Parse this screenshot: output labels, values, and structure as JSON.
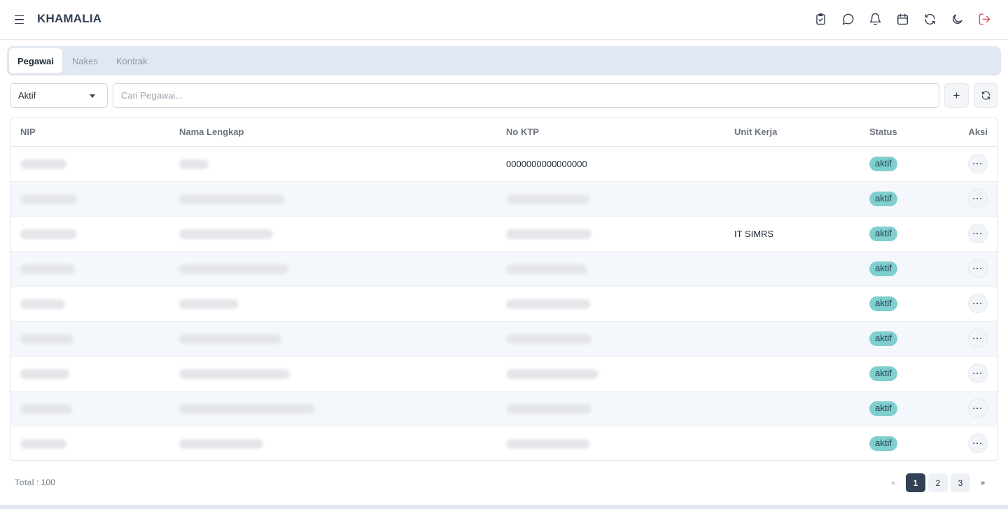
{
  "app": {
    "title": "KHAMALIA"
  },
  "header_icons": [
    "clipboard-check-icon",
    "chat-icon",
    "bell-icon",
    "calendar-icon",
    "refresh-icon",
    "moon-icon",
    "logout-icon"
  ],
  "colors": {
    "accent": "#334155",
    "badge": "#7fcfce",
    "logout": "#e05252",
    "tabs_bg": "#e2e8f2"
  },
  "tabs": [
    {
      "label": "Pegawai",
      "active": true
    },
    {
      "label": "Nakes",
      "active": false
    },
    {
      "label": "Kontrak",
      "active": false
    }
  ],
  "filter": {
    "selected": "Aktif"
  },
  "search": {
    "placeholder": "Cari Pegawai...",
    "value": ""
  },
  "buttons": {
    "add": "+",
    "refresh": "refresh-icon"
  },
  "table": {
    "columns": [
      "NIP",
      "Nama Lengkap",
      "No KTP",
      "Unit Kerja",
      "Status",
      "Aksi"
    ],
    "rows": [
      {
        "nip": "",
        "nama": "",
        "ktp": "0000000000000000",
        "unit": "",
        "status": "aktif"
      },
      {
        "nip": "",
        "nama": "",
        "ktp": "",
        "unit": "",
        "status": "aktif"
      },
      {
        "nip": "",
        "nama": "",
        "ktp": "",
        "unit": "IT SIMRS",
        "status": "aktif"
      },
      {
        "nip": "",
        "nama": "",
        "ktp": "",
        "unit": "",
        "status": "aktif"
      },
      {
        "nip": "",
        "nama": "",
        "ktp": "",
        "unit": "",
        "status": "aktif"
      },
      {
        "nip": "",
        "nama": "",
        "ktp": "",
        "unit": "",
        "status": "aktif"
      },
      {
        "nip": "",
        "nama": "",
        "ktp": "",
        "unit": "",
        "status": "aktif"
      },
      {
        "nip": "",
        "nama": "",
        "ktp": "",
        "unit": "",
        "status": "aktif"
      },
      {
        "nip": "",
        "nama": "",
        "ktp": "",
        "unit": "",
        "status": "aktif"
      }
    ],
    "action_label": "···"
  },
  "footer": {
    "total_label": "Total",
    "total_value": ": 100"
  },
  "pagination": {
    "prev": "«",
    "pages": [
      "1",
      "2",
      "3"
    ],
    "current": "1",
    "next": "»"
  }
}
